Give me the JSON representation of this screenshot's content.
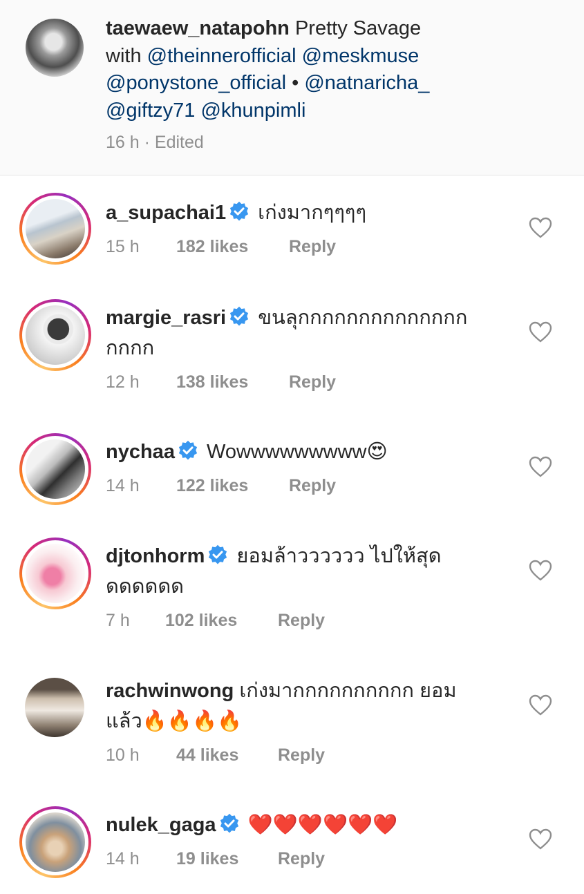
{
  "post": {
    "username": "taewaew_natapohn",
    "caption_text": "Pretty Savage",
    "with_word": "with",
    "mentions": [
      "@theinnerofficial",
      "@meskmuse",
      "@ponystone_official",
      "@natnaricha_",
      "@giftzy71",
      "@khunpimli"
    ],
    "separator": "•",
    "time": "16 h",
    "edited": "· Edited"
  },
  "reply_label": "Reply",
  "comments": [
    {
      "username": "a_supachai1",
      "verified": true,
      "text": "เก่งมากๆๆๆๆ",
      "time": "15 h",
      "likes": "182 likes"
    },
    {
      "username": "margie_rasri",
      "verified": true,
      "text": "ขนลุกกกกกกกกกกกกกก",
      "text2": "กกกก",
      "time": "12 h",
      "likes": "138 likes"
    },
    {
      "username": "nychaa",
      "verified": true,
      "text": "Wowwwwwwwww😍",
      "time": "14 h",
      "likes": "122 likes"
    },
    {
      "username": "djtonhorm",
      "verified": true,
      "text": "ยอมล้าวววววว ไปให้สุด",
      "text2": "ดดดดดด",
      "time": "7 h",
      "likes": "102 likes"
    },
    {
      "username": "rachwinwong",
      "verified": false,
      "text": "เก่งมากกกกกกกกกก ยอม",
      "text2": "แล้ว🔥🔥🔥🔥",
      "time": "10 h",
      "likes": "44 likes"
    },
    {
      "username": "nulek_gaga",
      "verified": true,
      "text": "❤️❤️❤️❤️❤️❤️",
      "time": "14 h",
      "likes": "19 likes"
    }
  ],
  "icons": {
    "verified": "verified-badge-icon",
    "heart": "heart-outline-icon"
  },
  "colors": {
    "mention": "#003569",
    "verified": "#3897f0",
    "meta": "#8e8e8e"
  }
}
